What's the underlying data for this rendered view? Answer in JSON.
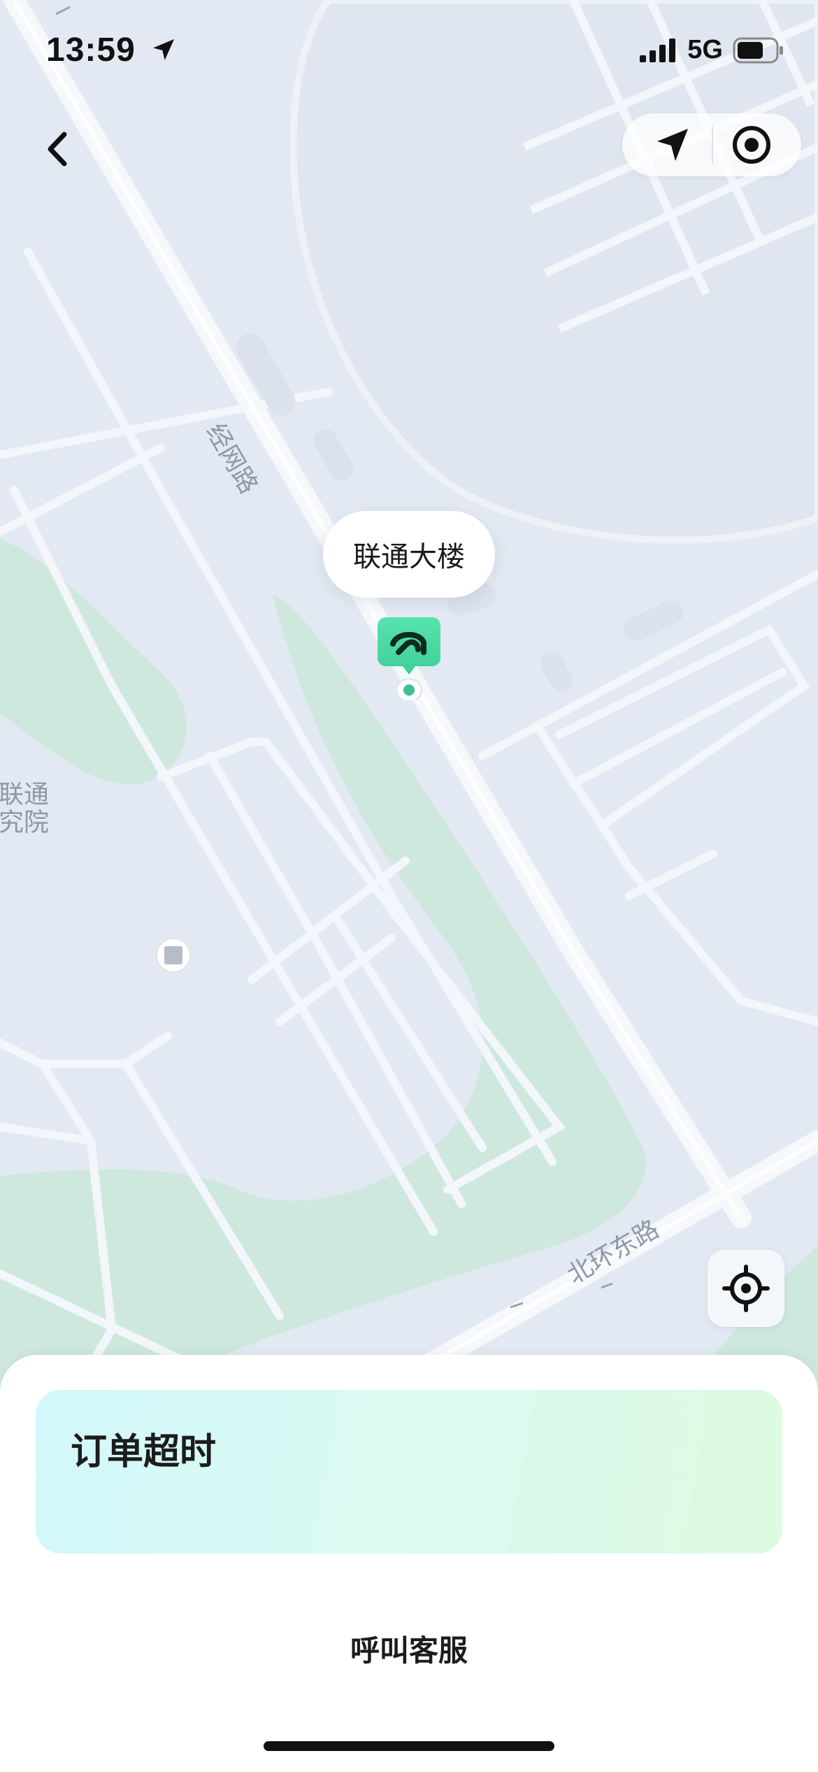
{
  "status_bar": {
    "time": "13:59",
    "network": "5G",
    "icons": [
      "location-arrow-icon",
      "signal-icon",
      "battery-icon"
    ]
  },
  "map": {
    "labels": {
      "road_jingwang": "经网路",
      "road_beihuan_east": "北环东路",
      "poi_line1": "国联通",
      "poi_line2": "研究院"
    },
    "callout": "联通大楼",
    "colors": {
      "background": "#e3e9f2",
      "road": "#f3f6fa",
      "green": "#cfe8de",
      "marker": "#4fd8a4"
    }
  },
  "toolbar": {
    "back_icon": "chevron-left-icon",
    "navigate_icon": "navigation-arrow-icon",
    "target_icon": "target-icon",
    "locate_icon": "crosshair-icon"
  },
  "sheet": {
    "status_title": "订单超时",
    "service_button": "呼叫客服"
  }
}
